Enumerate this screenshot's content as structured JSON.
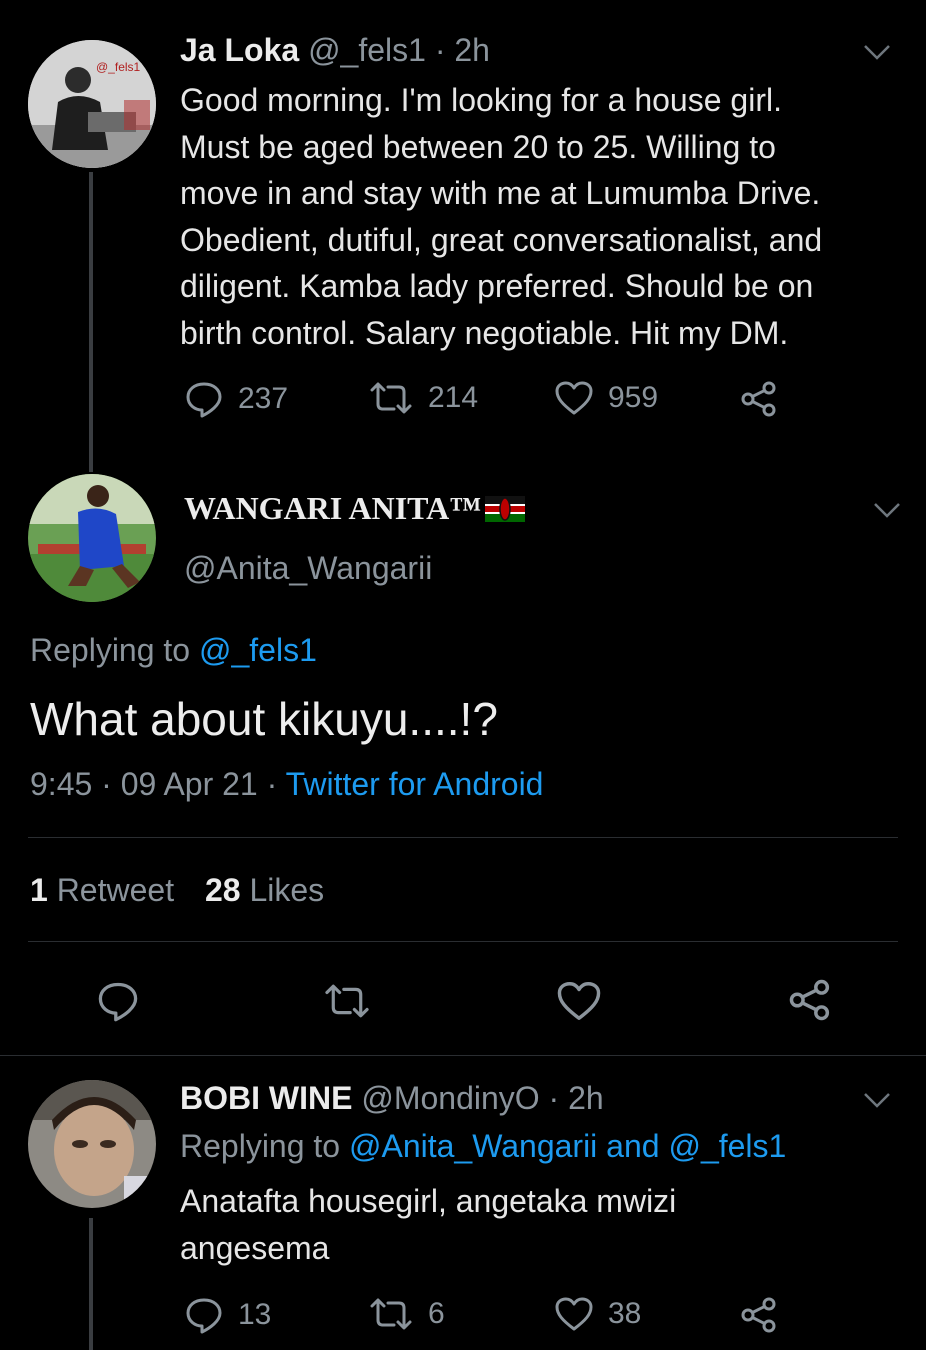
{
  "tweet1": {
    "name": "Ja Loka",
    "handle": "@_fels1",
    "time": "· 2h",
    "avatar_watermark": "@_fels1",
    "text_lines": [
      "Good morning. I'm looking for a house girl.",
      "Must be aged between 20 to 25. Willing to",
      "move in and stay with me at Lumumba Drive.",
      "Obedient, dutiful, great conversationalist, and",
      "diligent. Kamba lady preferred. Should be on",
      "birth control. Salary negotiable. Hit my DM."
    ],
    "replies": "237",
    "retweets": "214",
    "likes": "959"
  },
  "tweet2": {
    "name": "WANGARI ANITA™",
    "flag": "kenya-flag",
    "handle": "@Anita_Wangarii",
    "replying_prefix": "Replying to",
    "replying_handle": "@_fels1",
    "text": "What about kikuyu....!?",
    "timestamp": "9:45 · 09 Apr 21 ·",
    "source": "Twitter for Android",
    "retweet_count": "1",
    "retweet_label": "Retweet",
    "like_count": "28",
    "like_label": "Likes"
  },
  "tweet3": {
    "name": "BOBI WINE",
    "handle": "@MondinyO",
    "time": "· 2h",
    "replying_prefix": "Replying to",
    "replying_handles": "@Anita_Wangarii and @_fels1",
    "text_lines": [
      "Anatafta housegirl, angetaka mwizi",
      "angesema"
    ],
    "replies": "13",
    "retweets": "6",
    "likes": "38"
  },
  "icons": {
    "reply": "reply-icon",
    "retweet": "retweet-icon",
    "like": "heart-icon",
    "share": "share-icon",
    "menu": "chevron-down-icon"
  },
  "colors": {
    "background": "#000000",
    "link": "#1d9bf0",
    "muted": "#8b949c",
    "text": "#e6e6e6"
  }
}
